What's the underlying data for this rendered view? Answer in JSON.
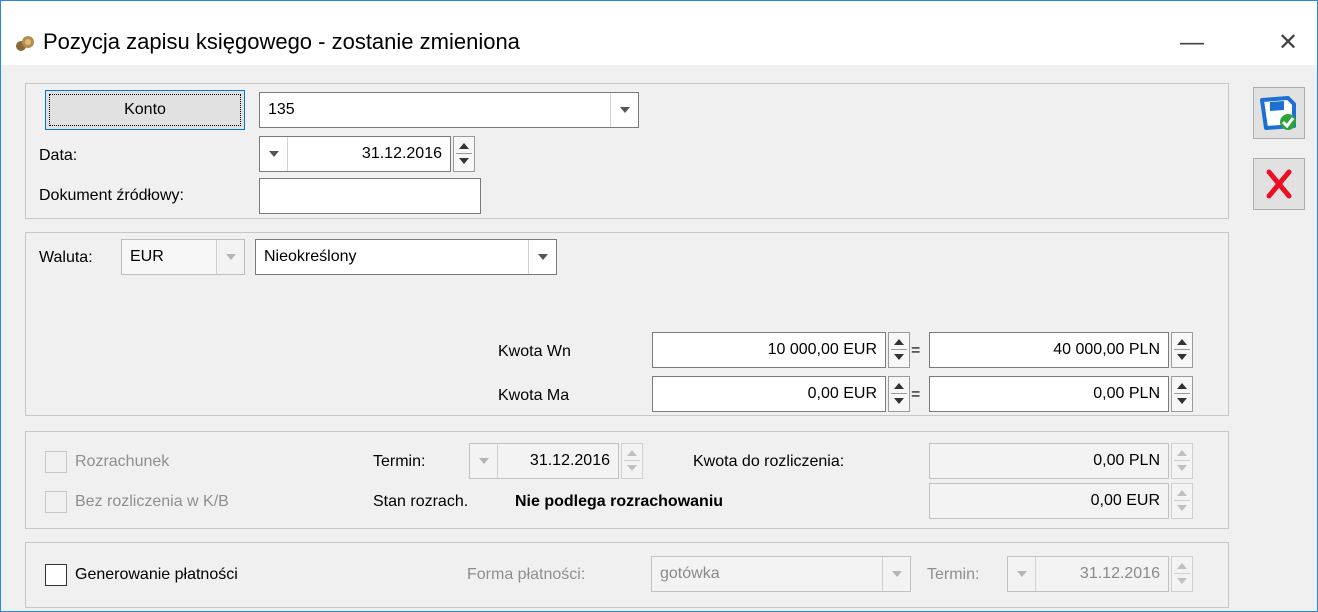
{
  "window": {
    "title": "Pozycja zapisu księgowego - zostanie zmieniona",
    "minimize_glyph": "—",
    "close_glyph": "✕"
  },
  "section_account": {
    "konto_button": "Konto",
    "konto_value": "135",
    "data_label": "Data:",
    "data_value": "31.12.2016",
    "dokument_label": "Dokument źródłowy:",
    "dokument_value": ""
  },
  "section_currency": {
    "waluta_label": "Waluta:",
    "waluta_value": "EUR",
    "kurs_value": "Nieokreślony",
    "kwota_wn_label": "Kwota Wn",
    "kwota_wn_currency": "10 000,00 EUR",
    "kwota_wn_pln": "40 000,00 PLN",
    "kwota_ma_label": "Kwota Ma",
    "kwota_ma_currency": "0,00 EUR",
    "kwota_ma_pln": "0,00 PLN",
    "equals": "="
  },
  "section_settlement": {
    "rozrachunek_label": "Rozrachunek",
    "bez_rozliczenia_label": "Bez rozliczenia w K/B",
    "termin_label": "Termin:",
    "termin_value": "31.12.2016",
    "kwota_do_rozliczenia_label": "Kwota do rozliczenia:",
    "kwota_do_rozliczenia_pln": "0,00 PLN",
    "kwota_do_rozliczenia_eur": "0,00 EUR",
    "stan_label": "Stan rozrach.",
    "stan_value": "Nie podlega rozrachowaniu"
  },
  "section_payment": {
    "generowanie_label": "Generowanie płatności",
    "forma_label": "Forma płatności:",
    "forma_value": "gotówka",
    "termin_label": "Termin:",
    "termin_value": "31.12.2016"
  },
  "side_buttons": {
    "save_icon": "save-icon",
    "cancel_icon": "cancel-icon"
  },
  "colors": {
    "accent": "#2b87d9",
    "cancel_red": "#e81123",
    "save_blue": "#1d6fd1",
    "save_green": "#2ea33a"
  }
}
